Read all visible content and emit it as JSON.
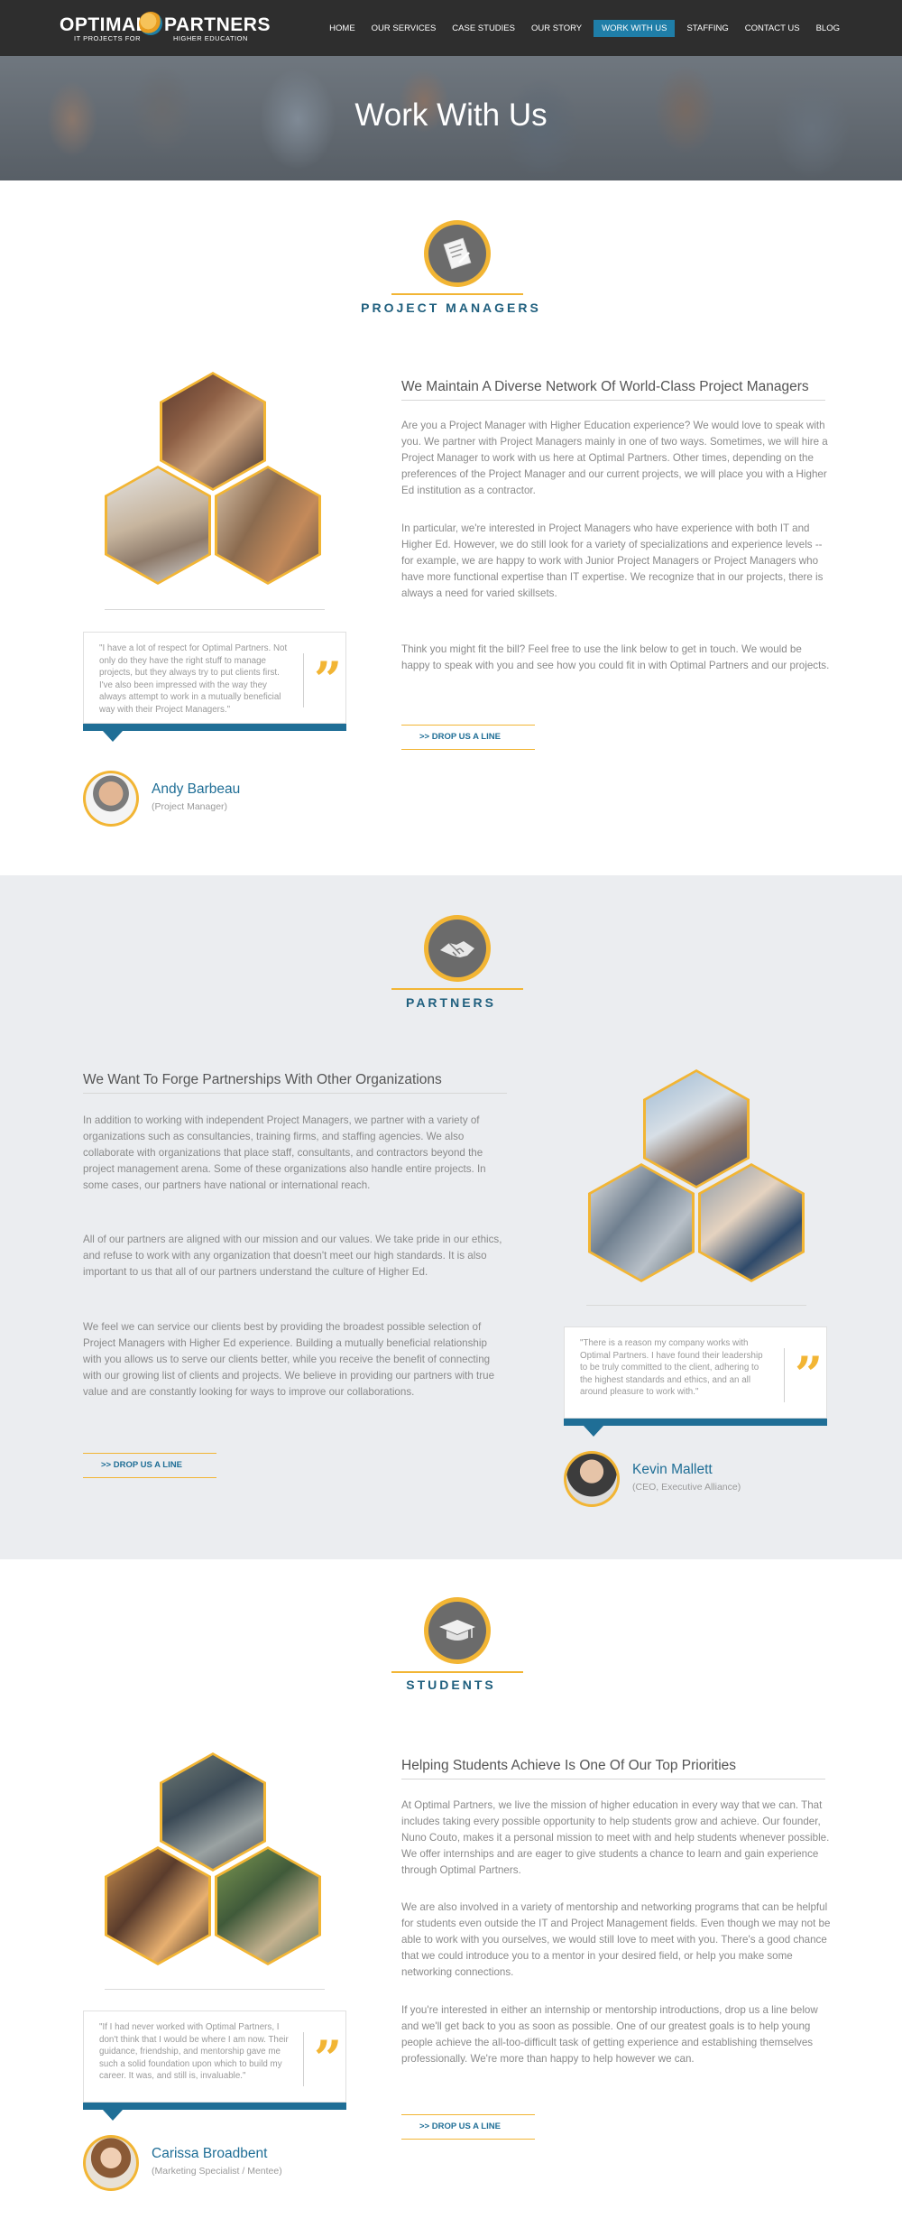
{
  "header": {
    "logo": {
      "word1": "OPTIMAL",
      "word2": "PARTNERS",
      "tag1": "IT PROJECTS FOR",
      "tag2": "HIGHER EDUCATION"
    },
    "nav": [
      "HOME",
      "OUR SERVICES",
      "CASE STUDIES",
      "OUR STORY",
      "WORK WITH US",
      "STAFFING",
      "CONTACT US",
      "BLOG"
    ],
    "nav_active": "WORK WITH US",
    "accent_color": "#1f7ea8"
  },
  "hero": {
    "title": "Work With Us"
  },
  "project_managers": {
    "section_title": "PROJECT MANAGERS",
    "icon": "document-icon",
    "heading": "We Maintain A Diverse Network Of World-Class Project Managers",
    "paragraphs": [
      "Are you a Project Manager with Higher Education experience? We would love to speak with you. We partner with Project Managers mainly in one of two ways. Sometimes, we will hire a Project Manager to work with us here at Optimal Partners. Other times, depending on the preferences of the Project Manager and our current projects, we will place you with a Higher Ed institution as a contractor.",
      "In particular, we're interested in Project Managers who have experience with both IT and Higher Ed. However, we do still look for a variety of specializations and experience levels -- for example, we are happy to work with Junior Project Managers or Project Managers who have more functional expertise than IT expertise. We recognize that in our projects, there is always a need for varied skillsets.",
      "Think you might fit the bill? Feel free to use the link below to get in touch. We would be happy to speak with you and see how you could fit in with Optimal Partners and our projects."
    ],
    "cta": ">>  DROP US A LINE",
    "testimonial": "\"I have a lot of respect for Optimal Partners. Not only do they have the right stuff to manage projects, but they always try to put clients first. I've also been impressed with the way they always attempt to work in a mutually beneficial way with their Project Managers.\"",
    "person_name": "Andy Barbeau",
    "person_role": "(Project Manager)"
  },
  "partners": {
    "section_title": "PARTNERS",
    "icon": "handshake-icon",
    "heading": "We Want To Forge Partnerships With Other Organizations",
    "paragraphs": [
      "In addition to working with independent Project Managers, we partner with a variety of organizations such as consultancies, training firms, and staffing agencies. We also collaborate with organizations that place staff, consultants, and contractors beyond the project management arena. Some of these organizations also handle entire projects. In some cases, our partners have national or international reach.",
      "All of our partners are aligned with our mission and our values. We take pride in our ethics, and refuse to work with any organization that doesn't meet our high standards. It is also important to us that all of our partners understand the culture of Higher Ed.",
      "We feel we can service our clients best by providing the broadest possible selection of Project Managers with Higher Ed experience. Building a mutually beneficial relationship with you allows us to serve our clients better, while you receive the benefit of connecting with our growing list of clients and projects. We believe in providing our partners with true value and are constantly looking for ways to improve our collaborations."
    ],
    "cta": ">>  DROP US A LINE",
    "testimonial": "\"There is a reason my company works with Optimal Partners. I have found their leadership to be truly committed to the client, adhering to the highest standards and ethics, and an all around pleasure to work with.\"",
    "person_name": "Kevin Mallett",
    "person_role": "(CEO, Executive Alliance)"
  },
  "students": {
    "section_title": "STUDENTS",
    "icon": "graduation-cap-icon",
    "heading": "Helping Students Achieve Is One Of Our Top Priorities",
    "paragraphs": [
      "At Optimal Partners, we live the mission of higher education in every way that we can. That includes taking every possible opportunity to help students grow and achieve. Our founder, Nuno Couto, makes it a personal mission to meet with and help students whenever possible. We offer internships and are eager to give students a chance to learn and gain experience through Optimal Partners.",
      "We are also involved in a variety of mentorship and networking programs that can be helpful for students even outside the IT and Project Management fields. Even though we may not be able to work with you ourselves, we would still love to meet with you. There's a good chance that we could introduce you to a mentor in your desired field, or help you make some networking connections.",
      "If you're interested in either an internship or mentorship introductions, drop us a line below and we'll get back to you as soon as possible. One of our greatest goals is to help young people achieve the all-too-difficult task of getting experience and establishing themselves professionally. We're more than happy to help however we can."
    ],
    "cta": ">>  DROP US A LINE",
    "testimonial": "\"If I had never worked with Optimal Partners, I don't think that I would be where I am now. Their guidance, friendship, and mentorship gave me such a solid foundation upon which to build my career. It was, and still is, invaluable.\"",
    "person_name": "Carissa Broadbent",
    "person_role": "(Marketing Specialist / Mentee)"
  }
}
